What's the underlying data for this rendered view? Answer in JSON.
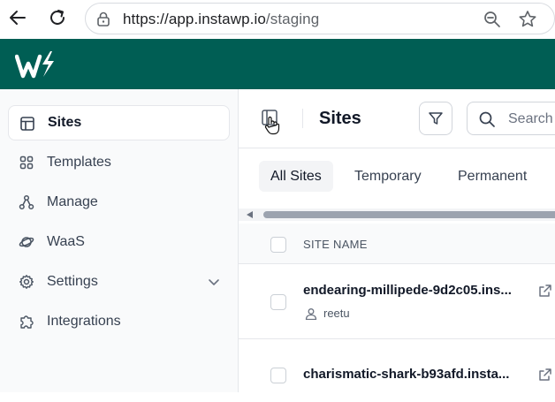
{
  "browser": {
    "url_domain": "https://app.instawp.io",
    "url_path": "/staging"
  },
  "sidebar": {
    "items": [
      {
        "label": "Sites",
        "icon": "layout-icon",
        "active": true
      },
      {
        "label": "Templates",
        "icon": "grid-icon"
      },
      {
        "label": "Manage",
        "icon": "network-icon"
      },
      {
        "label": "WaaS",
        "icon": "planet-icon"
      },
      {
        "label": "Settings",
        "icon": "gear-icon"
      },
      {
        "label": "Integrations",
        "icon": "puzzle-icon"
      }
    ]
  },
  "main": {
    "title": "Sites",
    "search_placeholder": "Search",
    "tabs": [
      {
        "label": "All Sites",
        "active": true
      },
      {
        "label": "Temporary"
      },
      {
        "label": "Permanent"
      }
    ],
    "table": {
      "column_site_name": "SITE NAME",
      "rows": [
        {
          "name": "endearing-millipede-9d2c05.ins...",
          "owner": "reetu"
        },
        {
          "name": "charismatic-shark-b93afd.insta..."
        }
      ]
    }
  },
  "colors": {
    "brand_header": "#005e54",
    "sidebar_bg": "#f9fafb"
  }
}
